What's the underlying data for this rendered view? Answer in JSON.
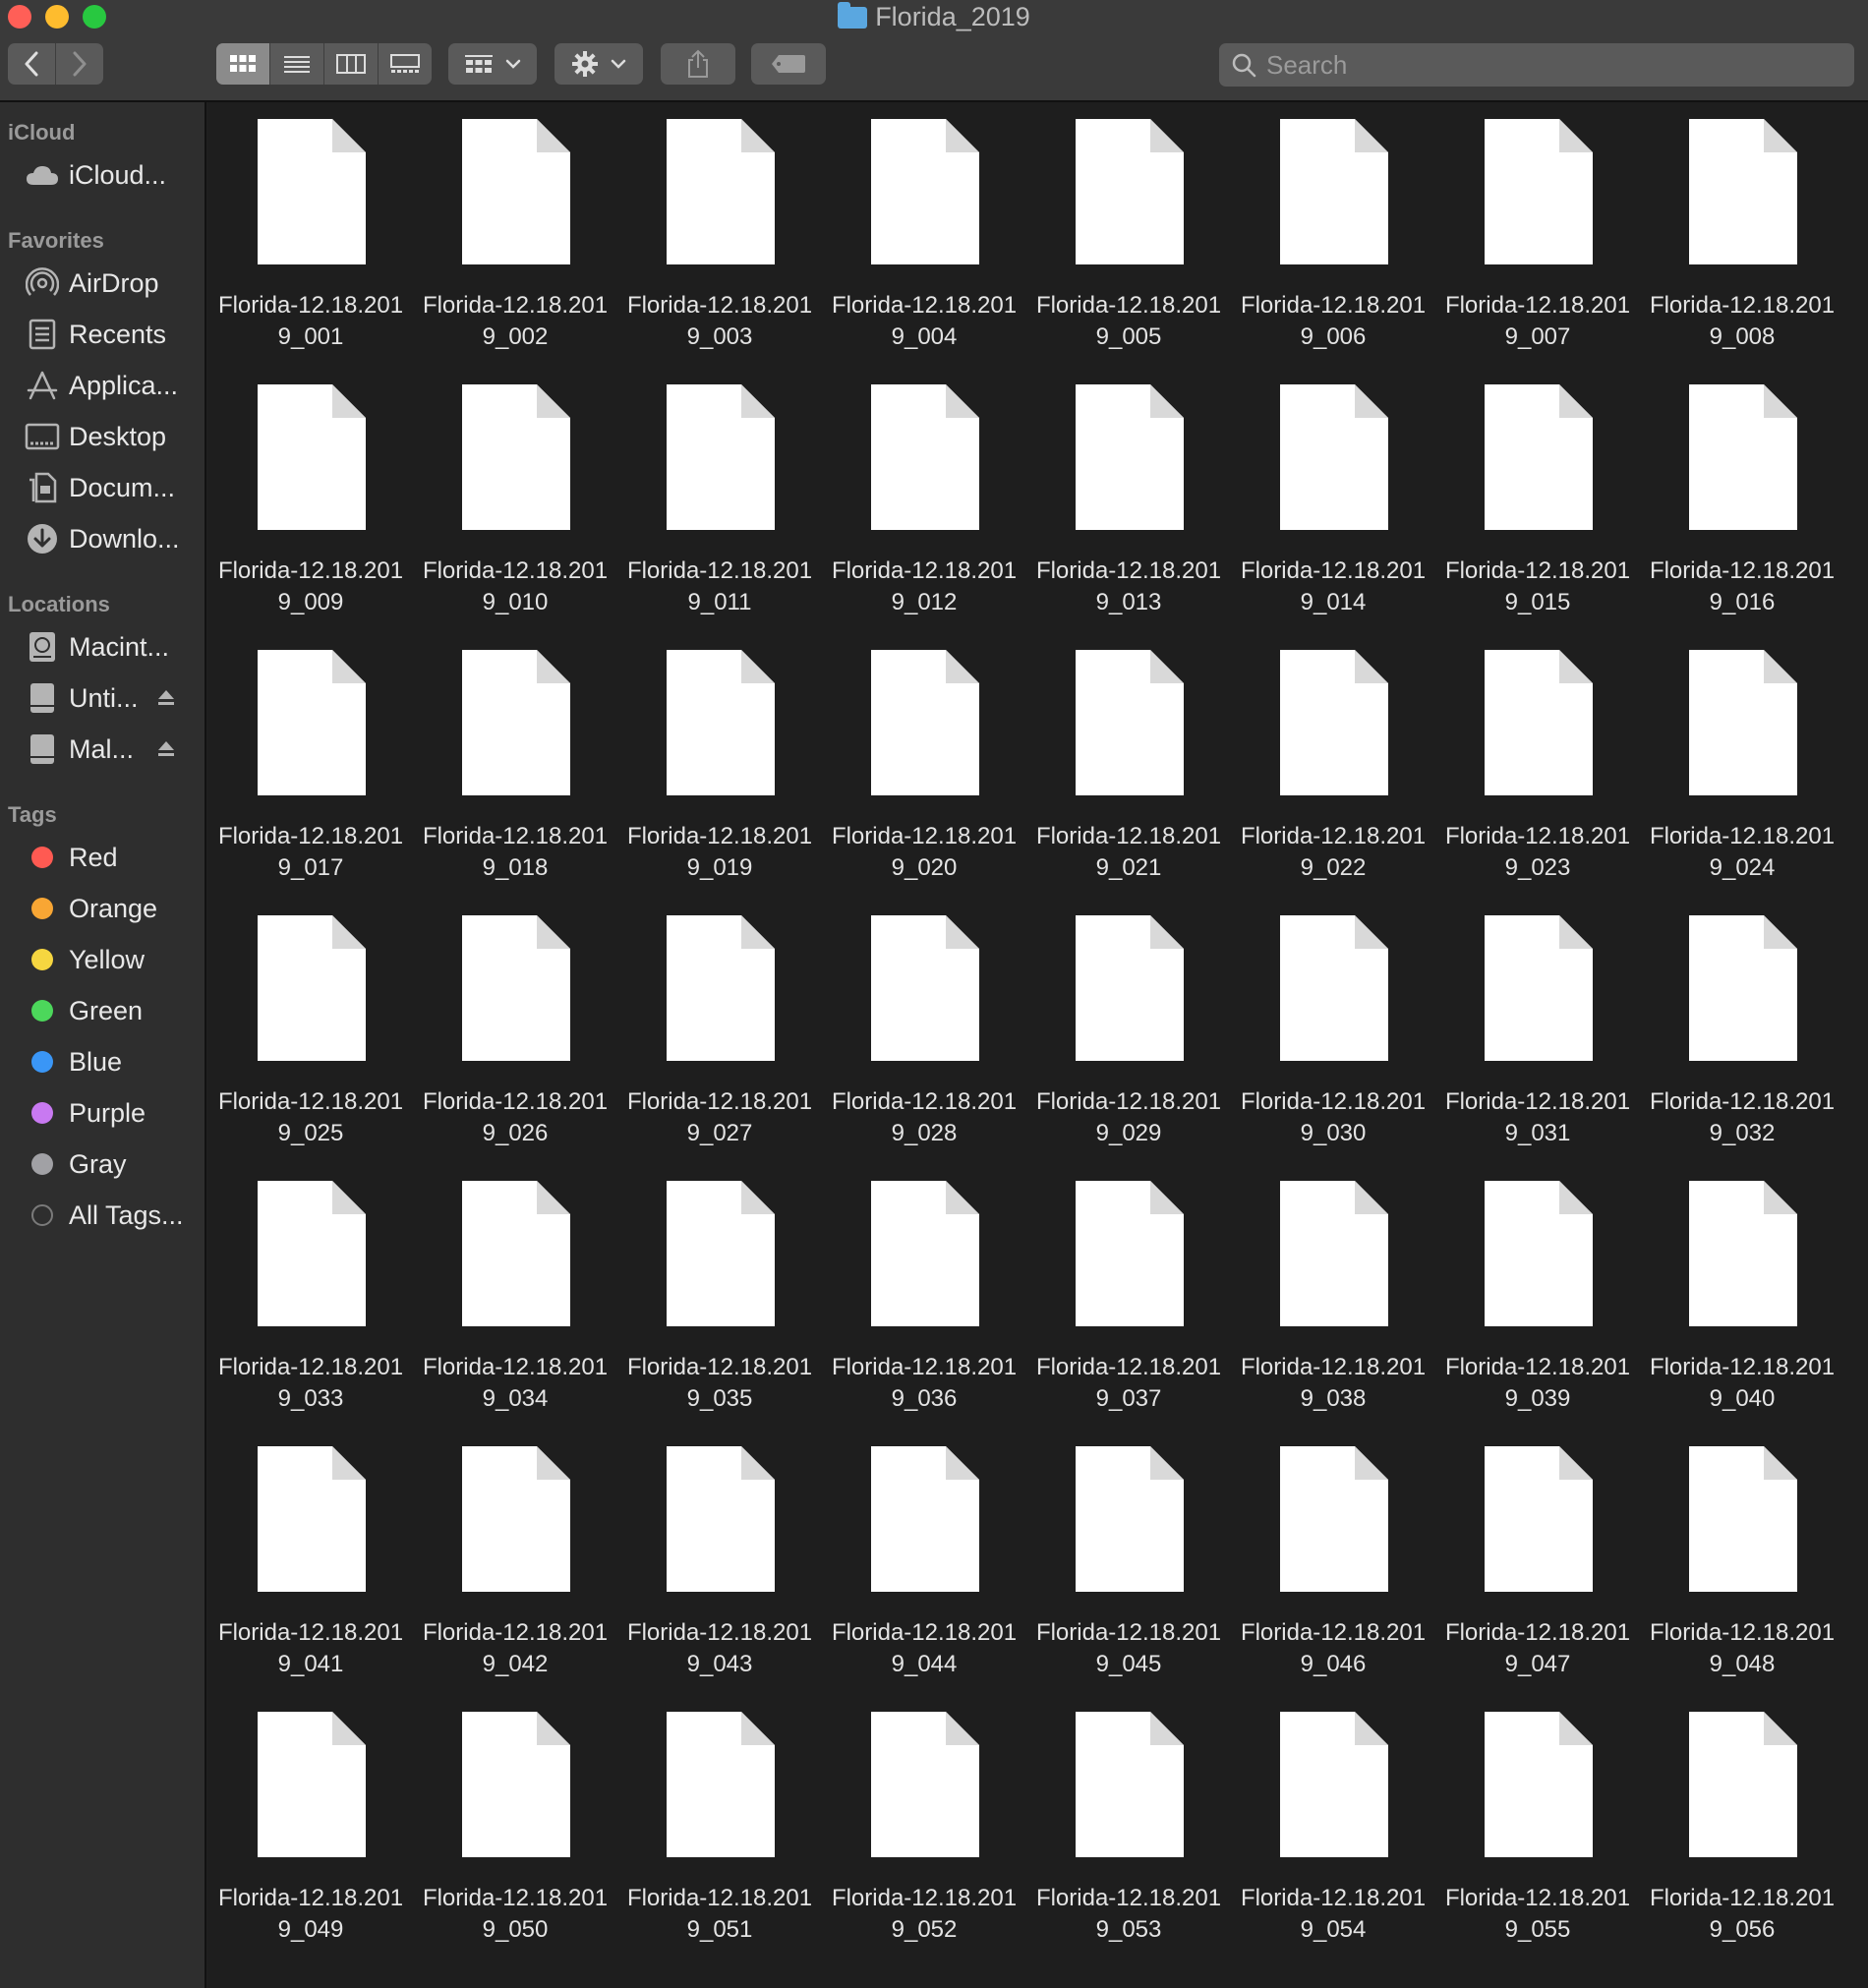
{
  "window": {
    "title": "Florida_2019"
  },
  "toolbar": {
    "search_placeholder": "Search",
    "views": [
      "icon-view",
      "list-view",
      "column-view",
      "gallery-view"
    ]
  },
  "sidebar": {
    "sections": [
      {
        "header": "iCloud",
        "items": [
          {
            "label": "iCloud...",
            "icon": "cloud-icon"
          }
        ]
      },
      {
        "header": "Favorites",
        "items": [
          {
            "label": "AirDrop",
            "icon": "airdrop-icon"
          },
          {
            "label": "Recents",
            "icon": "recents-icon"
          },
          {
            "label": "Applica...",
            "icon": "applications-icon"
          },
          {
            "label": "Desktop",
            "icon": "desktop-icon"
          },
          {
            "label": "Docum...",
            "icon": "documents-icon"
          },
          {
            "label": "Downlo...",
            "icon": "downloads-icon"
          }
        ]
      },
      {
        "header": "Locations",
        "items": [
          {
            "label": "Macint...",
            "icon": "hard-disk-icon"
          },
          {
            "label": "Unti...",
            "icon": "external-disk-icon",
            "eject": true
          },
          {
            "label": "Mal...",
            "icon": "external-disk-icon",
            "eject": true
          }
        ]
      },
      {
        "header": "Tags",
        "items": [
          {
            "label": "Red",
            "color": "#ff5a52"
          },
          {
            "label": "Orange",
            "color": "#f8a634"
          },
          {
            "label": "Yellow",
            "color": "#f6d640"
          },
          {
            "label": "Green",
            "color": "#4cd75b"
          },
          {
            "label": "Blue",
            "color": "#3a96f6"
          },
          {
            "label": "Purple",
            "color": "#c879f1"
          },
          {
            "label": "Gray",
            "color": "#a1a1a5"
          },
          {
            "label": "All Tags...",
            "color": "all"
          }
        ]
      }
    ]
  },
  "files": [
    "Florida-12.18.2019_001",
    "Florida-12.18.2019_002",
    "Florida-12.18.2019_003",
    "Florida-12.18.2019_004",
    "Florida-12.18.2019_005",
    "Florida-12.18.2019_006",
    "Florida-12.18.2019_007",
    "Florida-12.18.2019_008",
    "Florida-12.18.2019_009",
    "Florida-12.18.2019_010",
    "Florida-12.18.2019_011",
    "Florida-12.18.2019_012",
    "Florida-12.18.2019_013",
    "Florida-12.18.2019_014",
    "Florida-12.18.2019_015",
    "Florida-12.18.2019_016",
    "Florida-12.18.2019_017",
    "Florida-12.18.2019_018",
    "Florida-12.18.2019_019",
    "Florida-12.18.2019_020",
    "Florida-12.18.2019_021",
    "Florida-12.18.2019_022",
    "Florida-12.18.2019_023",
    "Florida-12.18.2019_024",
    "Florida-12.18.2019_025",
    "Florida-12.18.2019_026",
    "Florida-12.18.2019_027",
    "Florida-12.18.2019_028",
    "Florida-12.18.2019_029",
    "Florida-12.18.2019_030",
    "Florida-12.18.2019_031",
    "Florida-12.18.2019_032",
    "Florida-12.18.2019_033",
    "Florida-12.18.2019_034",
    "Florida-12.18.2019_035",
    "Florida-12.18.2019_036",
    "Florida-12.18.2019_037",
    "Florida-12.18.2019_038",
    "Florida-12.18.2019_039",
    "Florida-12.18.2019_040",
    "Florida-12.18.2019_041",
    "Florida-12.18.2019_042",
    "Florida-12.18.2019_043",
    "Florida-12.18.2019_044",
    "Florida-12.18.2019_045",
    "Florida-12.18.2019_046",
    "Florida-12.18.2019_047",
    "Florida-12.18.2019_048",
    "Florida-12.18.2019_049",
    "Florida-12.18.2019_050",
    "Florida-12.18.2019_051",
    "Florida-12.18.2019_052",
    "Florida-12.18.2019_053",
    "Florida-12.18.2019_054",
    "Florida-12.18.2019_055",
    "Florida-12.18.2019_056"
  ]
}
